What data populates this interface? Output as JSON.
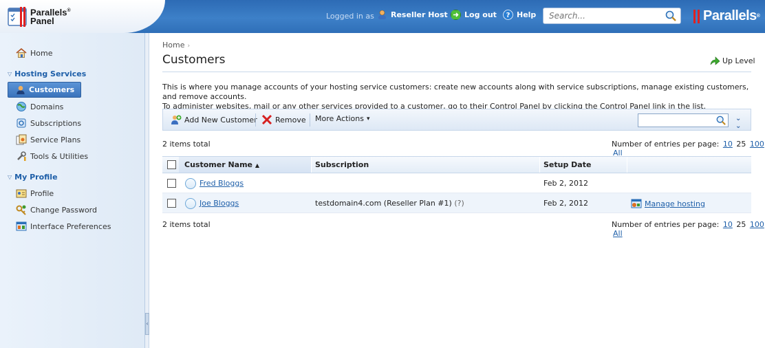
{
  "header": {
    "logo_line1": "Parallels",
    "logo_reg": "®",
    "logo_line2": "Panel",
    "logged_in_label": "Logged in as",
    "user_name": "Reseller Host",
    "logout_label": "Log out",
    "help_label": "Help",
    "search_placeholder": "Search...",
    "brand": "Parallels",
    "brand_reg": "®"
  },
  "sidebar": {
    "home": "Home",
    "hosting_section": "Hosting Services",
    "hosting_items": [
      {
        "label": "Customers",
        "icon": "customers-icon"
      },
      {
        "label": "Domains",
        "icon": "domains-icon"
      },
      {
        "label": "Subscriptions",
        "icon": "subscriptions-icon"
      },
      {
        "label": "Service Plans",
        "icon": "service-plans-icon"
      },
      {
        "label": "Tools & Utilities",
        "icon": "tools-icon"
      }
    ],
    "profile_section": "My Profile",
    "profile_items": [
      {
        "label": "Profile",
        "icon": "profile-icon"
      },
      {
        "label": "Change Password",
        "icon": "password-icon"
      },
      {
        "label": "Interface Preferences",
        "icon": "preferences-icon"
      }
    ]
  },
  "main": {
    "breadcrumb": "Home",
    "breadcrumb_sep": "›",
    "title": "Customers",
    "up_level": "Up Level",
    "description_line1": "This is where you manage accounts of your hosting service customers: create new accounts along with service subscriptions, manage existing customers, and remove accounts.",
    "description_line2": "To administer websites, mail or any other services provided to a customer, go to their Control Panel by clicking the Control Panel link in the list.",
    "toolbar": {
      "add_label": "Add New Customer",
      "remove_label": "Remove",
      "more_label": "More Actions",
      "more_caret": "▾"
    },
    "items_total": "2 items total",
    "per_page_label": "Number of entries per page:",
    "per_page_options": [
      "10",
      "25",
      "100",
      "All"
    ],
    "per_page_current": "25",
    "columns": {
      "name": "Customer Name",
      "sort_arrow": "▲",
      "subscription": "Subscription",
      "setup_date": "Setup Date"
    },
    "rows": [
      {
        "name": "Fred Bloggs",
        "subscription": "",
        "hint": "",
        "setup_date": "Feb 2, 2012",
        "action": ""
      },
      {
        "name": "Joe Bloggs",
        "subscription": "testdomain4.com (Reseller Plan #1)",
        "hint": "(?)",
        "setup_date": "Feb 2, 2012",
        "action": "Manage hosting"
      }
    ]
  },
  "colors": {
    "header_blue": "#3d80c8",
    "link_blue": "#1d5ea8",
    "brand_red": "#e02020"
  }
}
